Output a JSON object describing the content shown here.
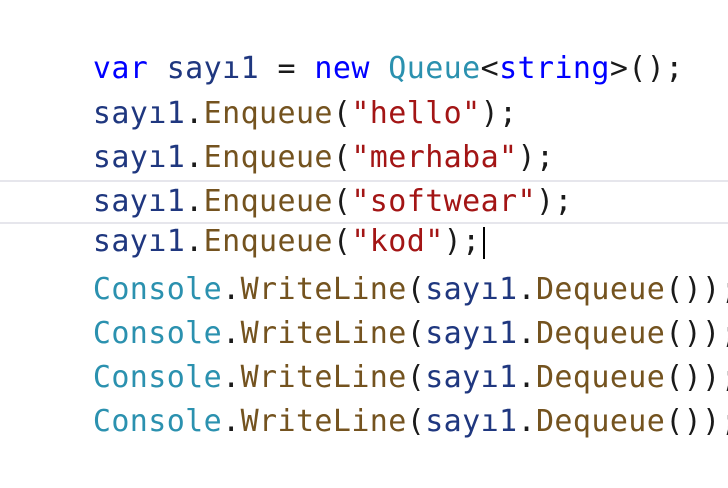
{
  "colors": {
    "keyword": "#0000ff",
    "type": "#2b91af",
    "variable": "#1f377f",
    "method": "#74531f",
    "string": "#a31515",
    "plain": "#1a1a1a",
    "current_line_border": "#e6e6ec"
  },
  "code": {
    "line1": {
      "kw_var": "var",
      "var_name": "sayı1",
      "assign": " = ",
      "kw_new": "new",
      "type_queue": "Queue",
      "lt": "<",
      "kw_string": "string",
      "gt_call": ">();"
    },
    "line2": {
      "var": "sayı1",
      "dot": ".",
      "method": "Enqueue",
      "open": "(",
      "str": "\"hello\"",
      "close": ");"
    },
    "line3": {
      "var": "sayı1",
      "dot": ".",
      "method": "Enqueue",
      "open": "(",
      "str": "\"merhaba\"",
      "close": ");"
    },
    "line4": {
      "var": "sayı1",
      "dot": ".",
      "method": "Enqueue",
      "open": "(",
      "str": "\"softwear\"",
      "close": ");"
    },
    "line5": {
      "var": "sayı1",
      "dot": ".",
      "method": "Enqueue",
      "open": "(",
      "str": "\"kod\"",
      "close": ");"
    },
    "writeline": {
      "type": "Console",
      "dot": ".",
      "method": "WriteLine",
      "open": "(",
      "var": "sayı1",
      "dot2": ".",
      "method2": "Dequeue",
      "close": "());"
    }
  }
}
